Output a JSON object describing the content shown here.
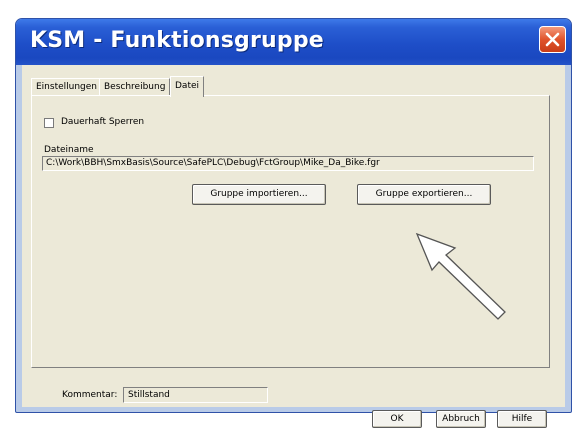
{
  "window": {
    "title": "KSM - Funktionsgruppe",
    "close_icon": "close-icon"
  },
  "tabs": [
    {
      "label": "Einstellungen",
      "active": false
    },
    {
      "label": "Beschreibung",
      "active": false
    },
    {
      "label": "Datei",
      "active": true
    }
  ],
  "datei": {
    "lock_label": "Dauerhaft Sperren",
    "lock_checked": false,
    "filename_label": "Dateiname",
    "filename_value": "C:\\Work\\BBH\\SmxBasis\\Source\\SafePLC\\Debug\\FctGroup\\Mike_Da_Bike.fgr",
    "import_button": "Gruppe importieren...",
    "export_button": "Gruppe exportieren..."
  },
  "footer": {
    "comment_label": "Kommentar:",
    "comment_value": "Stillstand",
    "ok_button": "OK",
    "cancel_button": "Abbruch",
    "help_button": "Hilfe"
  },
  "colors": {
    "titlebar": "#1e4ec8",
    "dialog_face": "#ece9d8",
    "close_button": "#e0532c"
  }
}
